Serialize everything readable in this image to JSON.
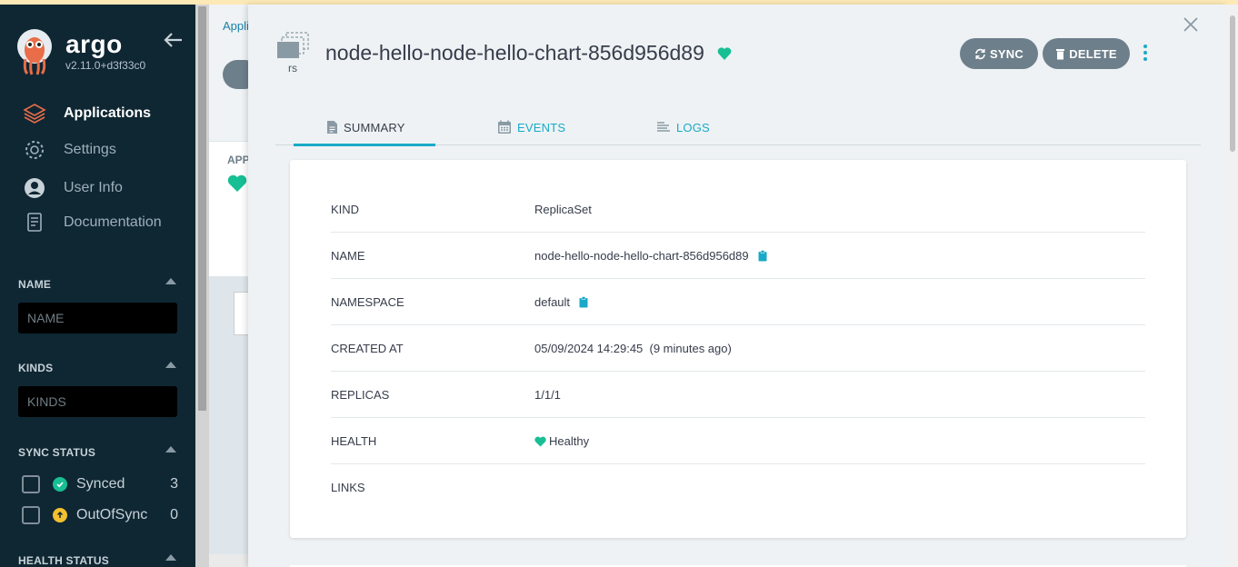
{
  "sidebar": {
    "brand": "argo",
    "version": "v2.11.0+d3f33c0",
    "nav": [
      {
        "label": "Applications",
        "icon": "layers-icon"
      },
      {
        "label": "Settings",
        "icon": "gear-icon"
      },
      {
        "label": "User Info",
        "icon": "user-circle-icon"
      },
      {
        "label": "Documentation",
        "icon": "book-icon"
      }
    ],
    "filters": {
      "name_label": "NAME",
      "name_placeholder": "NAME",
      "kinds_label": "KINDS",
      "kinds_placeholder": "KINDS",
      "sync_status_label": "SYNC STATUS",
      "sync_items": [
        {
          "label": "Synced",
          "count": "3",
          "color": "#18be94"
        },
        {
          "label": "OutOfSync",
          "count": "0",
          "color": "#f4c030"
        }
      ],
      "health_status_label": "HEALTH STATUS"
    }
  },
  "background": {
    "breadcrumb": "Applications",
    "app_header": "APP"
  },
  "panel": {
    "resource_kind_short": "rs",
    "title": "node-hello-node-hello-chart-856d956d89",
    "health_color": "#18be94",
    "buttons": {
      "sync": "SYNC",
      "delete": "DELETE"
    },
    "tabs": [
      {
        "label": "SUMMARY",
        "icon": "file-icon"
      },
      {
        "label": "EVENTS",
        "icon": "calendar-icon"
      },
      {
        "label": "LOGS",
        "icon": "logs-icon"
      }
    ],
    "summary": {
      "kind_key": "KIND",
      "kind_value": "ReplicaSet",
      "name_key": "NAME",
      "name_value": "node-hello-node-hello-chart-856d956d89",
      "namespace_key": "NAMESPACE",
      "namespace_value": "default",
      "created_key": "CREATED AT",
      "created_value": "05/09/2024 14:29:45  (9 minutes ago)",
      "replicas_key": "REPLICAS",
      "replicas_value": "1/1/1",
      "health_key": "HEALTH",
      "health_value": "Healthy",
      "links_key": "LINKS"
    }
  },
  "colors": {
    "accent": "#1aaac7",
    "sidebar_bg": "#0f2733",
    "button_bg": "#6d7f8b"
  }
}
